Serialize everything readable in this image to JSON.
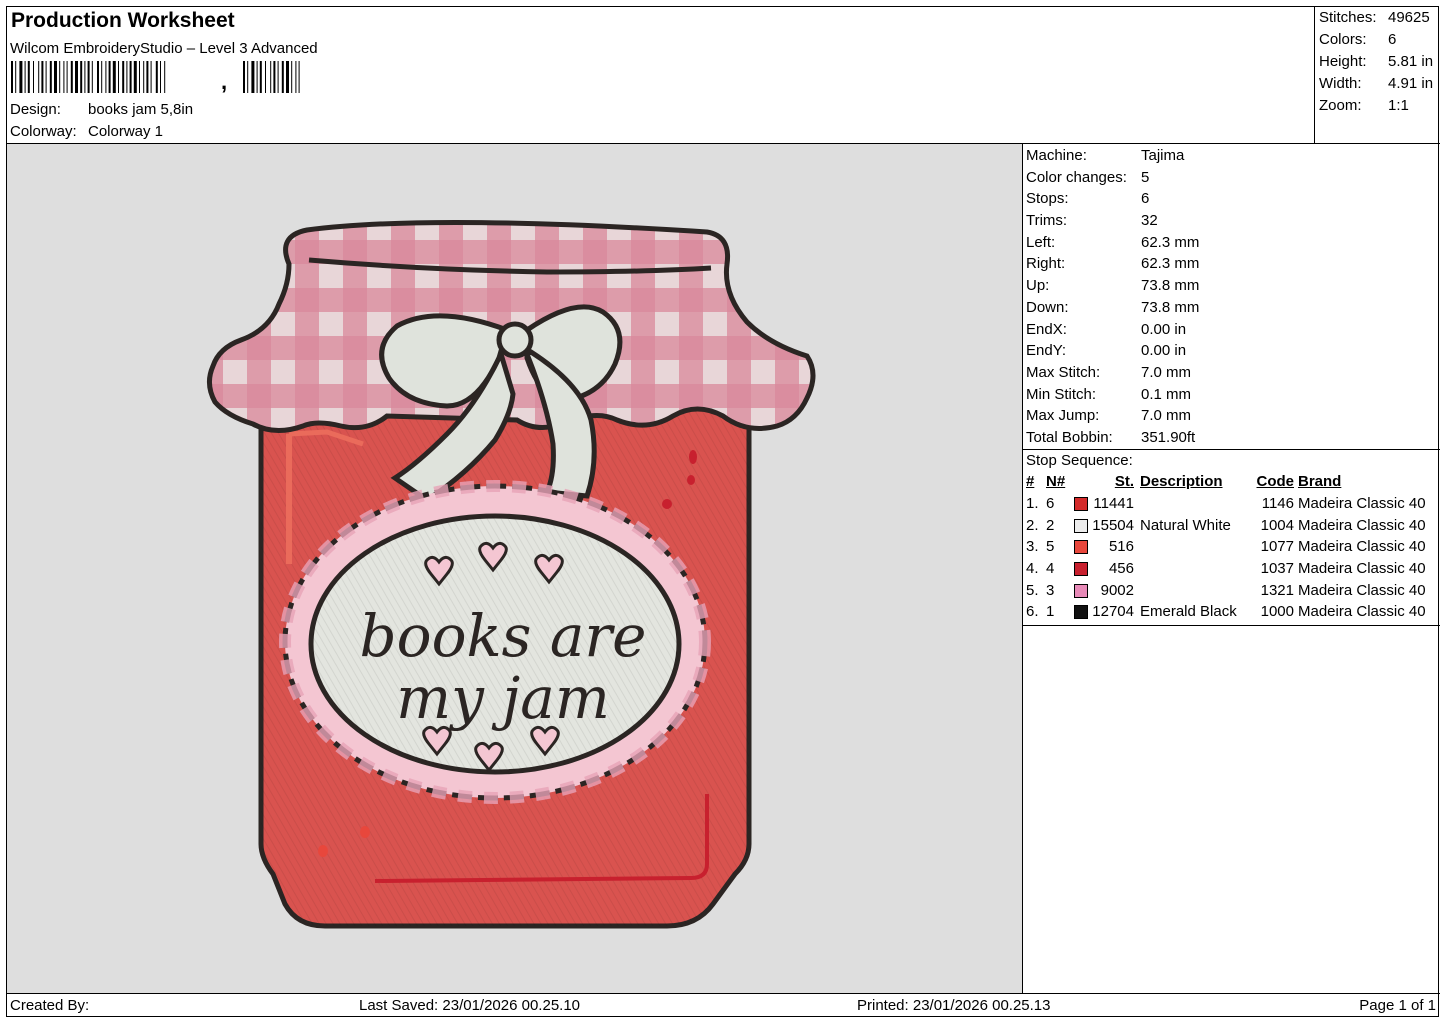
{
  "header": {
    "title": "Production Worksheet",
    "software": "Wilcom EmbroideryStudio – Level 3 Advanced",
    "barcode_suffix": ",",
    "design_label": "Design:",
    "design_value": "books jam 5,8in",
    "colorway_label": "Colorway:",
    "colorway_value": "Colorway 1"
  },
  "summary": [
    {
      "label": "Stitches:",
      "value": "49625"
    },
    {
      "label": "Colors:",
      "value": "6"
    },
    {
      "label": "Height:",
      "value": "5.81 in"
    },
    {
      "label": "Width:",
      "value": "4.91 in"
    },
    {
      "label": "Zoom:",
      "value": "1:1"
    }
  ],
  "machine_info": [
    {
      "label": "Machine:",
      "value": "Tajima"
    },
    {
      "label": "Color changes:",
      "value": "5"
    },
    {
      "label": "Stops:",
      "value": "6"
    },
    {
      "label": "Trims:",
      "value": "32"
    },
    {
      "label": "Left:",
      "value": "62.3 mm"
    },
    {
      "label": "Right:",
      "value": "62.3 mm"
    },
    {
      "label": "Up:",
      "value": "73.8 mm"
    },
    {
      "label": "Down:",
      "value": "73.8 mm"
    },
    {
      "label": "EndX:",
      "value": "0.00 in"
    },
    {
      "label": "EndY:",
      "value": "0.00 in"
    },
    {
      "label": "Max Stitch:",
      "value": "7.0 mm"
    },
    {
      "label": "Min Stitch:",
      "value": "0.1 mm"
    },
    {
      "label": "Max Jump:",
      "value": "7.0 mm"
    },
    {
      "label": "Total Bobbin:",
      "value": "351.90ft"
    }
  ],
  "stop_sequence": {
    "title": "Stop Sequence:",
    "headers": {
      "num": "#",
      "n": "N#",
      "st": "St.",
      "desc": "Description",
      "code": "Code",
      "brand": "Brand"
    },
    "rows": [
      {
        "num": "1.",
        "n": "6",
        "color": "#d42a2a",
        "st": "11441",
        "desc": "",
        "code": "1146",
        "brand": "Madeira Classic 40"
      },
      {
        "num": "2.",
        "n": "2",
        "color": "#ececec",
        "st": "15504",
        "desc": "Natural White",
        "code": "1004",
        "brand": "Madeira Classic 40"
      },
      {
        "num": "3.",
        "n": "5",
        "color": "#e8473c",
        "st": "516",
        "desc": "",
        "code": "1077",
        "brand": "Madeira Classic 40"
      },
      {
        "num": "4.",
        "n": "4",
        "color": "#c8202e",
        "st": "456",
        "desc": "",
        "code": "1037",
        "brand": "Madeira Classic 40"
      },
      {
        "num": "5.",
        "n": "3",
        "color": "#e88ab8",
        "st": "9002",
        "desc": "",
        "code": "1321",
        "brand": "Madeira Classic 40"
      },
      {
        "num": "6.",
        "n": "1",
        "color": "#111111",
        "st": "12704",
        "desc": "Emerald Black",
        "code": "1000",
        "brand": "Madeira Classic 40"
      }
    ]
  },
  "design_text": {
    "line1": "books are",
    "line2": "my jam"
  },
  "footer": {
    "created": "Created By:",
    "saved": "Last Saved: 23/01/2026 00.25.10",
    "printed": "Printed: 23/01/2026 00.25.13",
    "page": "Page 1 of 1"
  }
}
